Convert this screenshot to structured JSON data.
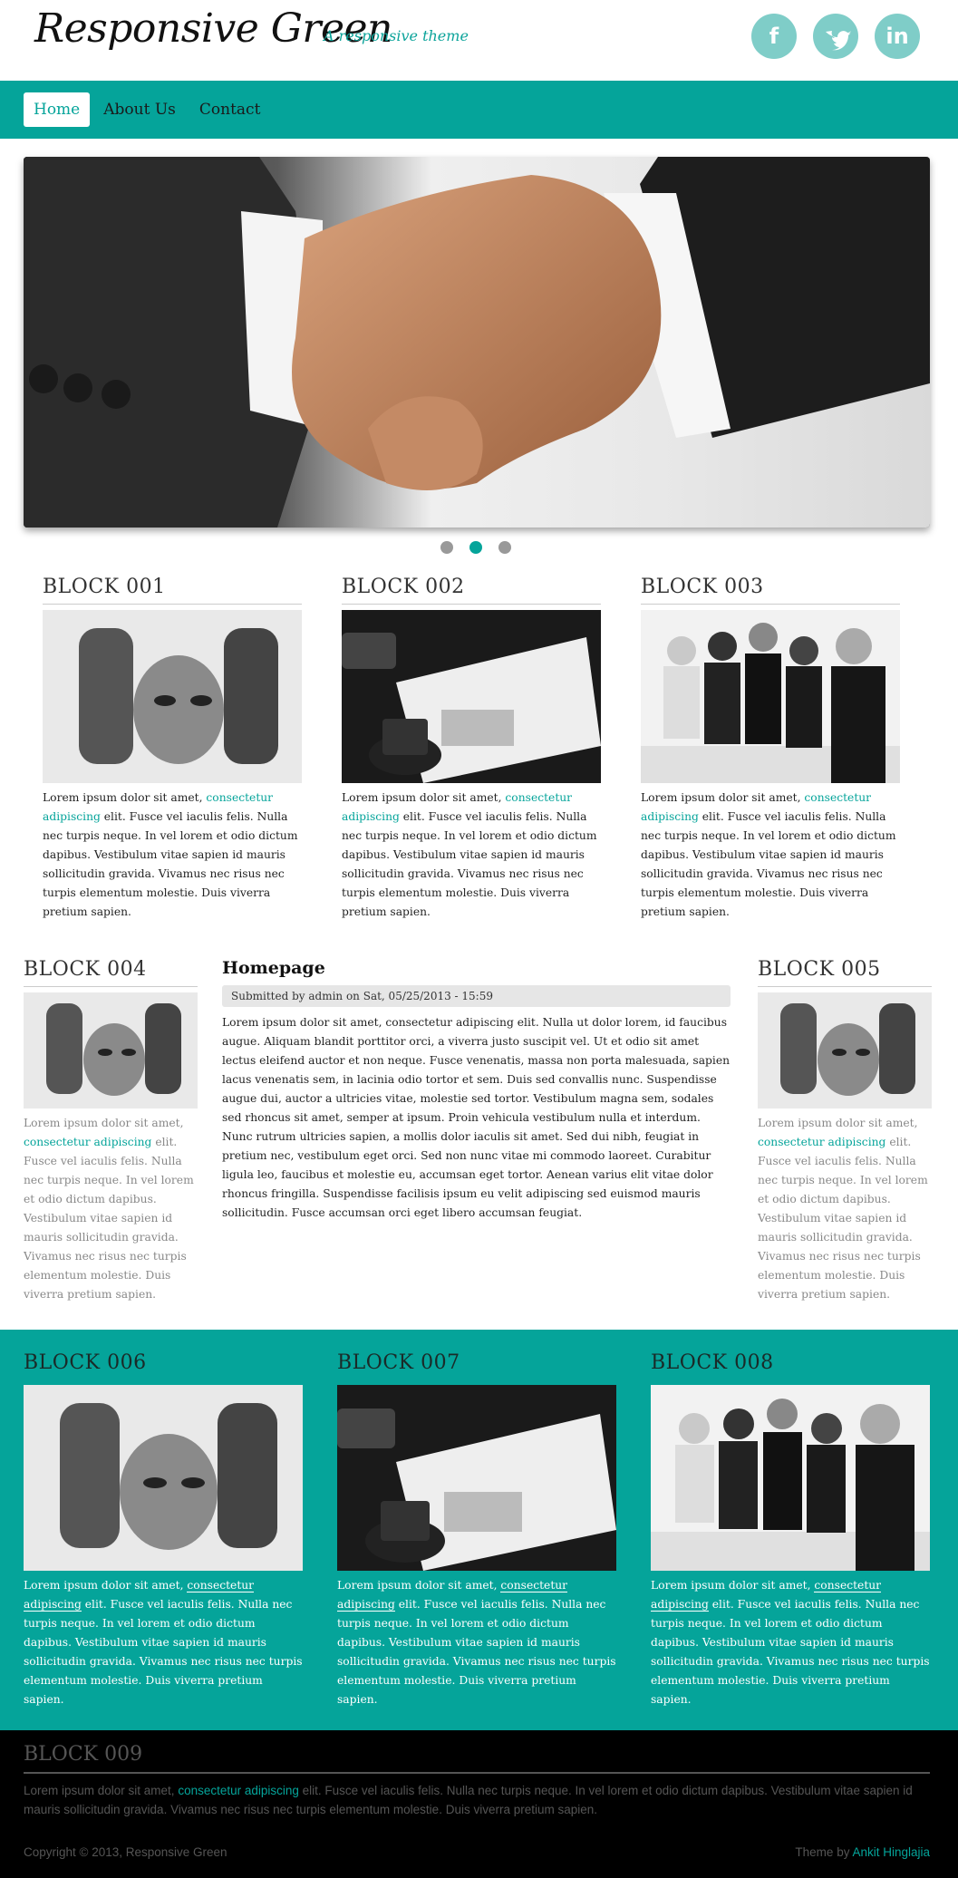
{
  "header": {
    "site_name": "Responsive Green",
    "slogan": "A responsive theme",
    "social": [
      {
        "icon": "facebook-icon",
        "glyph": "f"
      },
      {
        "icon": "twitter-icon",
        "glyph": "t"
      },
      {
        "icon": "linkedin-icon",
        "glyph": "in"
      }
    ]
  },
  "nav": {
    "items": [
      {
        "label": "Home",
        "active": true
      },
      {
        "label": "About Us",
        "active": false
      },
      {
        "label": "Contact",
        "active": false
      }
    ]
  },
  "slider": {
    "image": "handshake-image",
    "dots": 3,
    "active_dot": 2
  },
  "lorem_prefix": "Lorem ipsum dolor sit amet, ",
  "lorem_link": "consectetur adipiscing",
  "lorem_suffix": " elit. Fusce vel iaculis felis. Nulla nec turpis neque. In vel lorem et odio dictum dapibus. Vestibulum vitae sapien id mauris sollicitudin gravida. Vivamus nec risus nec turpis elementum molestie. Duis viverra pretium sapien.",
  "top_blocks": [
    {
      "title": "BLOCK 001",
      "image": "framing-hands-image"
    },
    {
      "title": "BLOCK 002",
      "image": "paperwork-image"
    },
    {
      "title": "BLOCK 003",
      "image": "team-applause-image"
    }
  ],
  "side_blocks": [
    {
      "title": "BLOCK 004",
      "image": "framing-hands-image"
    },
    {
      "title": "BLOCK 005",
      "image": "framing-hands-image"
    }
  ],
  "main": {
    "title": "Homepage",
    "submitted": "Submitted by admin on Sat, 05/25/2013 - 15:59",
    "body": "Lorem ipsum dolor sit amet, consectetur adipiscing elit. Nulla ut dolor lorem, id faucibus augue. Aliquam blandit porttitor orci, a viverra justo suscipit vel. Ut et odio sit amet lectus eleifend auctor et non neque. Fusce venenatis, massa non porta malesuada, sapien lacus venenatis sem, in lacinia odio tortor et sem. Duis sed convallis nunc. Suspendisse augue dui, auctor a ultricies vitae, molestie sed tortor. Vestibulum magna sem, sodales sed rhoncus sit amet, semper at ipsum. Proin vehicula vestibulum nulla et interdum. Nunc rutrum ultricies sapien, a mollis dolor iaculis sit amet. Sed dui nibh, feugiat in pretium nec, vestibulum eget orci. Sed non nunc vitae mi commodo laoreet. Curabitur ligula leo, faucibus et molestie eu, accumsan eget tortor. Aenean varius elit vitae dolor rhoncus fringilla. Suspendisse facilisis ipsum eu velit adipiscing sed euismod mauris sollicitudin. Fusce accumsan orci eget libero accumsan feugiat."
  },
  "teal_blocks": [
    {
      "title": "BLOCK 006",
      "image": "framing-hands-image"
    },
    {
      "title": "BLOCK 007",
      "image": "paperwork-image"
    },
    {
      "title": "BLOCK 008",
      "image": "team-applause-image"
    }
  ],
  "footer": {
    "title": "BLOCK 009",
    "text_prefix": "Lorem ipsum dolor sit amet, ",
    "text_link": "consectetur adipiscing",
    "text_suffix": " elit. Fusce vel iaculis felis. Nulla nec turpis neque. In vel lorem et odio dictum dapibus. Vestibulum vitae sapien id mauris sollicitudin gravida. Vivamus nec risus nec turpis elementum molestie. Duis viverra pretium sapien.",
    "copyright": "Copyright © 2013, Responsive Green",
    "credit_prefix": "Theme by ",
    "credit_link": "Ankit Hinglajia"
  },
  "colors": {
    "accent": "#05a49a",
    "social": "#7fcdc8",
    "footer_bg": "#000000"
  }
}
